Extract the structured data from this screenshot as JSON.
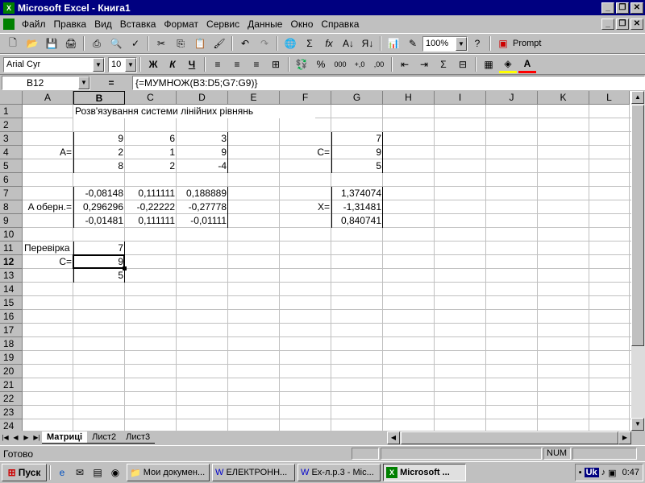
{
  "window": {
    "title": "Microsoft Excel - Книга1"
  },
  "menu": [
    "Файл",
    "Правка",
    "Вид",
    "Вставка",
    "Формат",
    "Сервис",
    "Данные",
    "Окно",
    "Справка"
  ],
  "toolbar": {
    "zoom": "100%",
    "prompt_label": "Prompt",
    "font_name": "Arial Cyr",
    "font_size": "10",
    "thousands": "000",
    "dec_inc": "+,0",
    "dec_dec": ",00"
  },
  "formula_bar": {
    "cell_ref": "B12",
    "equals": "=",
    "formula": "{=МУМНОЖ(B3:D5;G7:G9)}"
  },
  "columns": [
    "A",
    "B",
    "C",
    "D",
    "E",
    "F",
    "G",
    "H",
    "I",
    "J",
    "K",
    "L"
  ],
  "rows": [
    "1",
    "2",
    "3",
    "4",
    "5",
    "6",
    "7",
    "8",
    "9",
    "10",
    "11",
    "12",
    "13",
    "14",
    "15",
    "16",
    "17",
    "18",
    "19",
    "20",
    "21",
    "22",
    "23",
    "24"
  ],
  "cells": {
    "B1": "Розв'язування системи лінійних рівнянь",
    "B3": "9",
    "C3": "6",
    "D3": "3",
    "A4": "A=",
    "B4": "2",
    "C4": "1",
    "D4": "9",
    "B5": "8",
    "C5": "2",
    "D5": "-4",
    "F4": "C=",
    "G3": "7",
    "G4": "9",
    "G5": "5",
    "B7": "-0,08148",
    "C7": "0,111111",
    "D7": "0,188889",
    "A8": "A оберн.=",
    "B8": "0,296296",
    "C8": "-0,22222",
    "D8": "-0,27778",
    "B9": "-0,01481",
    "C9": "0,111111",
    "D9": "-0,01111",
    "G7": "1,374074",
    "F8": "X=",
    "G8": "-1,31481",
    "G9": "0,840741",
    "A11": "Перевірка",
    "B11": "7",
    "A12": "C=",
    "B12": "9",
    "B13": "5"
  },
  "sheet_tabs": [
    "Матриці",
    "Лист2",
    "Лист3"
  ],
  "status": {
    "text": "Готово",
    "num": "NUM"
  },
  "taskbar": {
    "start": "Пуск",
    "tasks": [
      "Мои докумен...",
      "ЕЛЕКТРОНН...",
      "Ex-л.р.3 - Mic...",
      "Microsoft ..."
    ],
    "clock": "0:47",
    "lang": "Uk"
  }
}
